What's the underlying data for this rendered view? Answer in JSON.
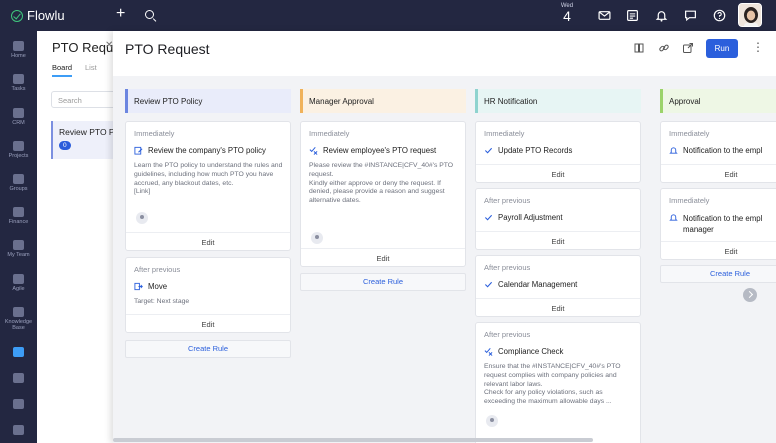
{
  "app": {
    "name": "Flowlu"
  },
  "topbar": {
    "day_name": "Wed",
    "day_number": "4"
  },
  "sidebar": {
    "items": [
      {
        "label": "Home",
        "icon": "home-icon"
      },
      {
        "label": "Tasks",
        "icon": "tasks-icon"
      },
      {
        "label": "CRM",
        "icon": "crm-icon"
      },
      {
        "label": "Projects",
        "icon": "projects-icon"
      },
      {
        "label": "Groups",
        "icon": "groups-icon"
      },
      {
        "label": "Finance",
        "icon": "finance-icon"
      },
      {
        "label": "My Team",
        "icon": "team-icon"
      },
      {
        "label": "Agile",
        "icon": "agile-icon"
      },
      {
        "label": "Knowledge Base",
        "icon": "knowledge-base-icon"
      },
      {
        "label": "",
        "icon": "workflow-icon"
      },
      {
        "label": "",
        "icon": "integrations-icon"
      },
      {
        "label": "",
        "icon": "settings-icon"
      },
      {
        "label": "",
        "icon": "apps-icon"
      }
    ]
  },
  "background_page": {
    "title": "PTO Requ",
    "tabs": [
      "Board",
      "List"
    ],
    "search_placeholder": "Search",
    "card_title": "Review PTO P",
    "card_badge": "0"
  },
  "panel": {
    "title": "PTO Request",
    "run_label": "Run",
    "create_rule_label": "Create Rule",
    "edit_label": "Edit",
    "colors": {
      "accent": "#2b5fdc",
      "col1": "#6c86e0",
      "col2": "#f0b25a",
      "col3": "#8fd3cf",
      "col4": "#9bd36a"
    }
  },
  "columns": [
    {
      "title": "Review PTO Policy",
      "cards": [
        {
          "when": "Immediately",
          "action": "Review the company's PTO policy",
          "icon": "task-edit-icon",
          "desc": "Learn the PTO policy to understand the rules and guidelines, including how much PTO you have accrued, any blackout dates, etc.\n[Link]",
          "user": true
        },
        {
          "when": "After previous",
          "action": "Move",
          "icon": "move-icon",
          "desc": "Target: Next stage",
          "user": false
        }
      ]
    },
    {
      "title": "Manager Approval",
      "cards": [
        {
          "when": "Immediately",
          "action": "Review employee's PTO request",
          "icon": "approval-icon",
          "desc": "Please review the #INSTANCE|CFV_40#'s PTO request.\nKindly either approve or deny the request. If denied, please provide a reason and suggest alternative dates.",
          "user": true
        }
      ]
    },
    {
      "title": "HR Notification",
      "cards": [
        {
          "when": "Immediately",
          "action": "Update PTO Records",
          "icon": "check-icon",
          "desc": "",
          "user": false
        },
        {
          "when": "After previous",
          "action": "Payroll Adjustment",
          "icon": "check-icon",
          "desc": "",
          "user": false
        },
        {
          "when": "After previous",
          "action": "Calendar Management",
          "icon": "check-icon",
          "desc": "",
          "user": false
        },
        {
          "when": "After previous",
          "action": "Compliance Check",
          "icon": "approval-icon",
          "desc": "Ensure that the #INSTANCE|CFV_40#'s PTO request complies with company policies and relevant labor laws.\nCheck for any policy violations, such as exceeding the maximum allowable days ...",
          "user": true
        }
      ]
    },
    {
      "title": "Approval",
      "cards": [
        {
          "when": "Immediately",
          "action": "Notification to the empl",
          "icon": "bell-icon",
          "desc": "",
          "user": false
        },
        {
          "when": "Immediately",
          "action": "Notification to the empl\nmanager",
          "icon": "bell-icon",
          "desc": "",
          "user": false
        }
      ]
    }
  ]
}
